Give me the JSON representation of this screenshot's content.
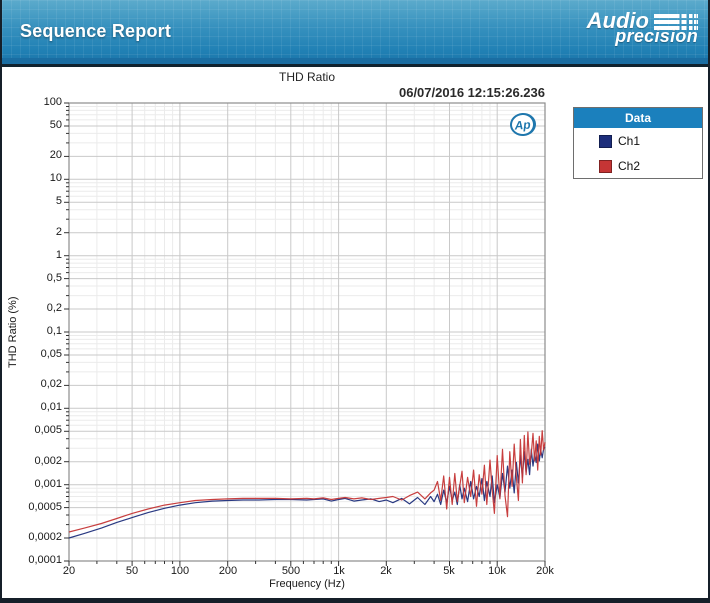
{
  "header": {
    "title": "Sequence Report",
    "logo": {
      "line1": "Audio",
      "line2": "precision"
    }
  },
  "report": {
    "title": "THD Ratio",
    "timestamp": "06/07/2016 12:15:26.236",
    "ap_badge": "Ap"
  },
  "legend": {
    "title": "Data",
    "entries": [
      {
        "label": "Ch1",
        "color": "#1d2e7b"
      },
      {
        "label": "Ch2",
        "color": "#c53535"
      }
    ]
  },
  "chart_data": {
    "type": "line",
    "title": "THD Ratio",
    "xlabel": "Frequency (Hz)",
    "ylabel": "THD Ratio (%)",
    "x_scale": "log",
    "y_scale": "log",
    "xlim": [
      20,
      20000
    ],
    "ylim": [
      0.0001,
      100
    ],
    "grid": true,
    "legend_position": "right",
    "x_ticks": [
      20,
      50,
      100,
      200,
      500,
      1000,
      2000,
      5000,
      10000,
      20000
    ],
    "x_tick_labels": [
      "20",
      "50",
      "100",
      "200",
      "500",
      "1k",
      "2k",
      "5k",
      "10k",
      "20k"
    ],
    "y_ticks": [
      100,
      50,
      20,
      10,
      5,
      2,
      1,
      0.5,
      0.2,
      0.1,
      0.05,
      0.02,
      0.01,
      0.005,
      0.002,
      0.001,
      0.0005,
      0.0002,
      0.0001
    ],
    "y_tick_labels": [
      "100",
      "50",
      "20",
      "10",
      "5",
      "2",
      "1",
      "0,5",
      "0,2",
      "0,1",
      "0,05",
      "0,02",
      "0,01",
      "0,005",
      "0,002",
      "0,001",
      "0,0005",
      "0,0002",
      "0,0001"
    ],
    "series": [
      {
        "name": "Ch1",
        "color": "#1d2e7b",
        "points": [
          [
            20,
            0.0002
          ],
          [
            25,
            0.00023
          ],
          [
            32,
            0.00027
          ],
          [
            40,
            0.00032
          ],
          [
            50,
            0.00037
          ],
          [
            63,
            0.00043
          ],
          [
            80,
            0.00049
          ],
          [
            100,
            0.00054
          ],
          [
            125,
            0.00058
          ],
          [
            160,
            0.00061
          ],
          [
            200,
            0.00062
          ],
          [
            250,
            0.00063
          ],
          [
            315,
            0.00063
          ],
          [
            400,
            0.00064
          ],
          [
            500,
            0.00064
          ],
          [
            630,
            0.00063
          ],
          [
            700,
            0.00064
          ],
          [
            800,
            0.00065
          ],
          [
            900,
            0.00061
          ],
          [
            1000,
            0.00064
          ],
          [
            1100,
            0.00066
          ],
          [
            1250,
            0.00061
          ],
          [
            1400,
            0.00063
          ],
          [
            1600,
            0.00065
          ],
          [
            1800,
            0.0006
          ],
          [
            2000,
            0.00063
          ],
          [
            2200,
            0.00058
          ],
          [
            2500,
            0.00066
          ],
          [
            2800,
            0.00056
          ],
          [
            3150,
            0.00068
          ],
          [
            3500,
            0.00055
          ],
          [
            3800,
            0.0007
          ],
          [
            4000,
            0.0006
          ],
          [
            4200,
            0.00075
          ],
          [
            4400,
            0.00055
          ],
          [
            4600,
            0.00085
          ],
          [
            4800,
            0.00058
          ],
          [
            5000,
            0.00095
          ],
          [
            5200,
            0.00062
          ],
          [
            5400,
            0.0008
          ],
          [
            5600,
            0.00055
          ],
          [
            5800,
            0.001
          ],
          [
            6000,
            0.00065
          ],
          [
            6200,
            0.0009
          ],
          [
            6500,
            0.0006
          ],
          [
            6800,
            0.0011
          ],
          [
            7100,
            0.00065
          ],
          [
            7400,
            0.00095
          ],
          [
            7700,
            0.0007
          ],
          [
            8000,
            0.0012
          ],
          [
            8300,
            0.00062
          ],
          [
            8600,
            0.0011
          ],
          [
            9000,
            0.0007
          ],
          [
            9300,
            0.0013
          ],
          [
            9600,
            0.00058
          ],
          [
            10000,
            0.001
          ],
          [
            10400,
            0.00068
          ],
          [
            10800,
            0.0014
          ],
          [
            11200,
            0.0008
          ],
          [
            11600,
            0.00175
          ],
          [
            12000,
            0.0009
          ],
          [
            12400,
            0.00155
          ],
          [
            12800,
            0.00078
          ],
          [
            13200,
            0.00195
          ],
          [
            13600,
            0.00105
          ],
          [
            14000,
            0.0024
          ],
          [
            14400,
            0.00125
          ],
          [
            14800,
            0.0027
          ],
          [
            15200,
            0.00145
          ],
          [
            15600,
            0.00215
          ],
          [
            16000,
            0.00135
          ],
          [
            16400,
            0.0029
          ],
          [
            16800,
            0.00175
          ],
          [
            17200,
            0.00255
          ],
          [
            17600,
            0.00195
          ],
          [
            18000,
            0.0034
          ],
          [
            18400,
            0.00205
          ],
          [
            18800,
            0.00285
          ],
          [
            19200,
            0.00225
          ],
          [
            19600,
            0.00295
          ],
          [
            20000,
            0.0031
          ]
        ]
      },
      {
        "name": "Ch2",
        "color": "#c53535",
        "points": [
          [
            20,
            0.00024
          ],
          [
            25,
            0.00027
          ],
          [
            32,
            0.00031
          ],
          [
            40,
            0.00036
          ],
          [
            50,
            0.00042
          ],
          [
            63,
            0.00048
          ],
          [
            80,
            0.00054
          ],
          [
            100,
            0.00058
          ],
          [
            125,
            0.00062
          ],
          [
            160,
            0.00064
          ],
          [
            200,
            0.00065
          ],
          [
            250,
            0.00066
          ],
          [
            315,
            0.00066
          ],
          [
            400,
            0.00066
          ],
          [
            500,
            0.00065
          ],
          [
            630,
            0.00066
          ],
          [
            700,
            0.00065
          ],
          [
            800,
            0.00067
          ],
          [
            900,
            0.00064
          ],
          [
            1000,
            0.00066
          ],
          [
            1100,
            0.00068
          ],
          [
            1250,
            0.00065
          ],
          [
            1400,
            0.00067
          ],
          [
            1600,
            0.00064
          ],
          [
            1800,
            0.00066
          ],
          [
            2000,
            0.00068
          ],
          [
            2200,
            0.0007
          ],
          [
            2500,
            0.00063
          ],
          [
            2800,
            0.00072
          ],
          [
            3150,
            0.0008
          ],
          [
            3500,
            0.00065
          ],
          [
            3800,
            0.00078
          ],
          [
            4000,
            0.00085
          ],
          [
            4200,
            0.0011
          ],
          [
            4400,
            0.00062
          ],
          [
            4600,
            0.0013
          ],
          [
            4800,
            0.00048
          ],
          [
            5000,
            0.00125
          ],
          [
            5200,
            0.00055
          ],
          [
            5400,
            0.0014
          ],
          [
            5600,
            0.0006
          ],
          [
            5800,
            0.00095
          ],
          [
            6000,
            0.0015
          ],
          [
            6200,
            0.00058
          ],
          [
            6500,
            0.00125
          ],
          [
            6800,
            0.0007
          ],
          [
            7100,
            0.00155
          ],
          [
            7400,
            0.00052
          ],
          [
            7700,
            0.00135
          ],
          [
            8000,
            0.00075
          ],
          [
            8300,
            0.0018
          ],
          [
            8600,
            0.00055
          ],
          [
            9000,
            0.0021
          ],
          [
            9300,
            0.00085
          ],
          [
            9600,
            0.00042
          ],
          [
            10000,
            0.0024
          ],
          [
            10400,
            0.00065
          ],
          [
            10800,
            0.0029
          ],
          [
            11200,
            0.00072
          ],
          [
            11600,
            0.00038
          ],
          [
            12000,
            0.0027
          ],
          [
            12400,
            0.00095
          ],
          [
            12800,
            0.0034
          ],
          [
            13200,
            0.00125
          ],
          [
            13600,
            0.00062
          ],
          [
            14000,
            0.0039
          ],
          [
            14400,
            0.00105
          ],
          [
            14800,
            0.0044
          ],
          [
            15200,
            0.00135
          ],
          [
            15600,
            0.0049
          ],
          [
            16000,
            0.00185
          ],
          [
            16400,
            0.00255
          ],
          [
            16800,
            0.0047
          ],
          [
            17200,
            0.00205
          ],
          [
            17600,
            0.00375
          ],
          [
            18000,
            0.00155
          ],
          [
            18400,
            0.0043
          ],
          [
            18800,
            0.00245
          ],
          [
            19200,
            0.0051
          ],
          [
            19600,
            0.00285
          ],
          [
            20000,
            0.0036
          ]
        ]
      }
    ]
  }
}
